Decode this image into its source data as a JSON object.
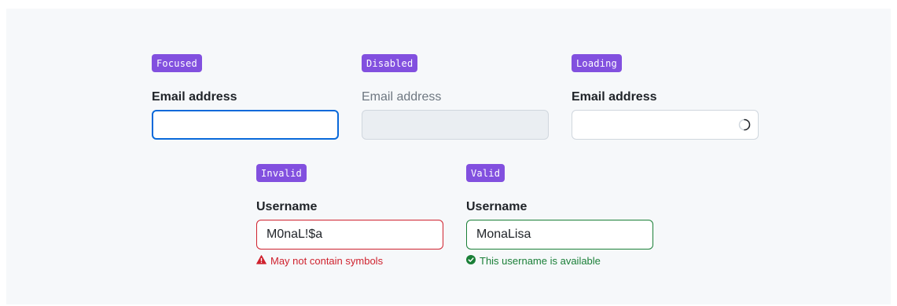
{
  "states": {
    "focused": {
      "tag": "Focused",
      "label": "Email address",
      "value": ""
    },
    "disabled": {
      "tag": "Disabled",
      "label": "Email address",
      "value": ""
    },
    "loading": {
      "tag": "Loading",
      "label": "Email address",
      "value": ""
    },
    "invalid": {
      "tag": "Invalid",
      "label": "Username",
      "value": "M0naL!$a",
      "message": "May not contain symbols"
    },
    "valid": {
      "tag": "Valid",
      "label": "Username",
      "value": "MonaLisa",
      "message": "This username is available"
    }
  },
  "icons": {
    "loading": "spinner-icon",
    "invalid": "alert-triangle-icon",
    "valid": "check-circle-icon"
  },
  "colors": {
    "tag_background": "#8250df",
    "focus_border": "#0969da",
    "error": "#cf222e",
    "success": "#1a7f37",
    "canvas_background": "#f6f8fa"
  }
}
